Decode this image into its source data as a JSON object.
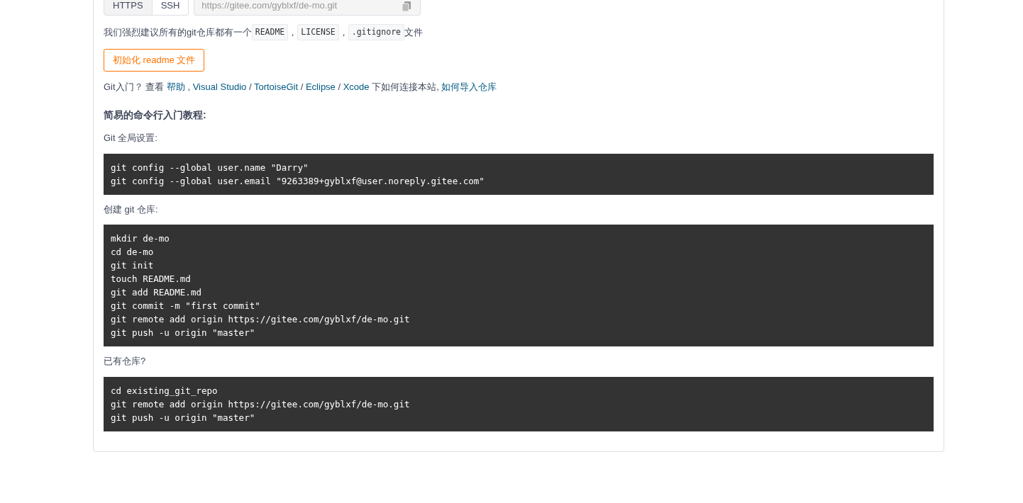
{
  "clone": {
    "tabs": [
      {
        "label": "HTTPS",
        "selected": true
      },
      {
        "label": "SSH",
        "selected": false
      }
    ],
    "url": "https://gitee.com/gyblxf/de-mo.git"
  },
  "recommend": [
    {
      "kind": "text",
      "text": "我们强烈建议所有的git仓库都有一个"
    },
    {
      "kind": "code",
      "text": "README"
    },
    {
      "kind": "text",
      "text": "，"
    },
    {
      "kind": "code",
      "text": "LICENSE"
    },
    {
      "kind": "text",
      "text": "，"
    },
    {
      "kind": "code",
      "text": ".gitignore"
    },
    {
      "kind": "text",
      "text": "文件"
    }
  ],
  "init_button": "初始化 readme 文件",
  "guide": [
    {
      "kind": "text",
      "text": "Git入门？ 查看 "
    },
    {
      "kind": "link",
      "text": "帮助"
    },
    {
      "kind": "text",
      "text": " , "
    },
    {
      "kind": "link",
      "text": "Visual Studio"
    },
    {
      "kind": "text",
      "text": " / "
    },
    {
      "kind": "link",
      "text": "TortoiseGit"
    },
    {
      "kind": "text",
      "text": " / "
    },
    {
      "kind": "link",
      "text": "Eclipse"
    },
    {
      "kind": "text",
      "text": " / "
    },
    {
      "kind": "link",
      "text": "Xcode"
    },
    {
      "kind": "text",
      "text": " 下如何连接本站, "
    },
    {
      "kind": "link",
      "text": "如何导入仓库"
    }
  ],
  "tutorial_title": "简易的命令行入门教程:",
  "sections": [
    {
      "label": "Git 全局设置:",
      "code": [
        "git config --global user.name \"Darry\"",
        "git config --global user.email \"9263389+gyblxf@user.noreply.gitee.com\""
      ]
    },
    {
      "label": "创建 git 仓库:",
      "code": [
        "mkdir de-mo",
        "cd de-mo",
        "git init",
        "touch README.md",
        "git add README.md",
        "git commit -m \"first commit\"",
        "git remote add origin https://gitee.com/gyblxf/de-mo.git",
        "git push -u origin \"master\""
      ]
    },
    {
      "label": "已有仓库?",
      "code": [
        "cd existing_git_repo",
        "git remote add origin https://gitee.com/gyblxf/de-mo.git",
        "git push -u origin \"master\""
      ]
    }
  ]
}
